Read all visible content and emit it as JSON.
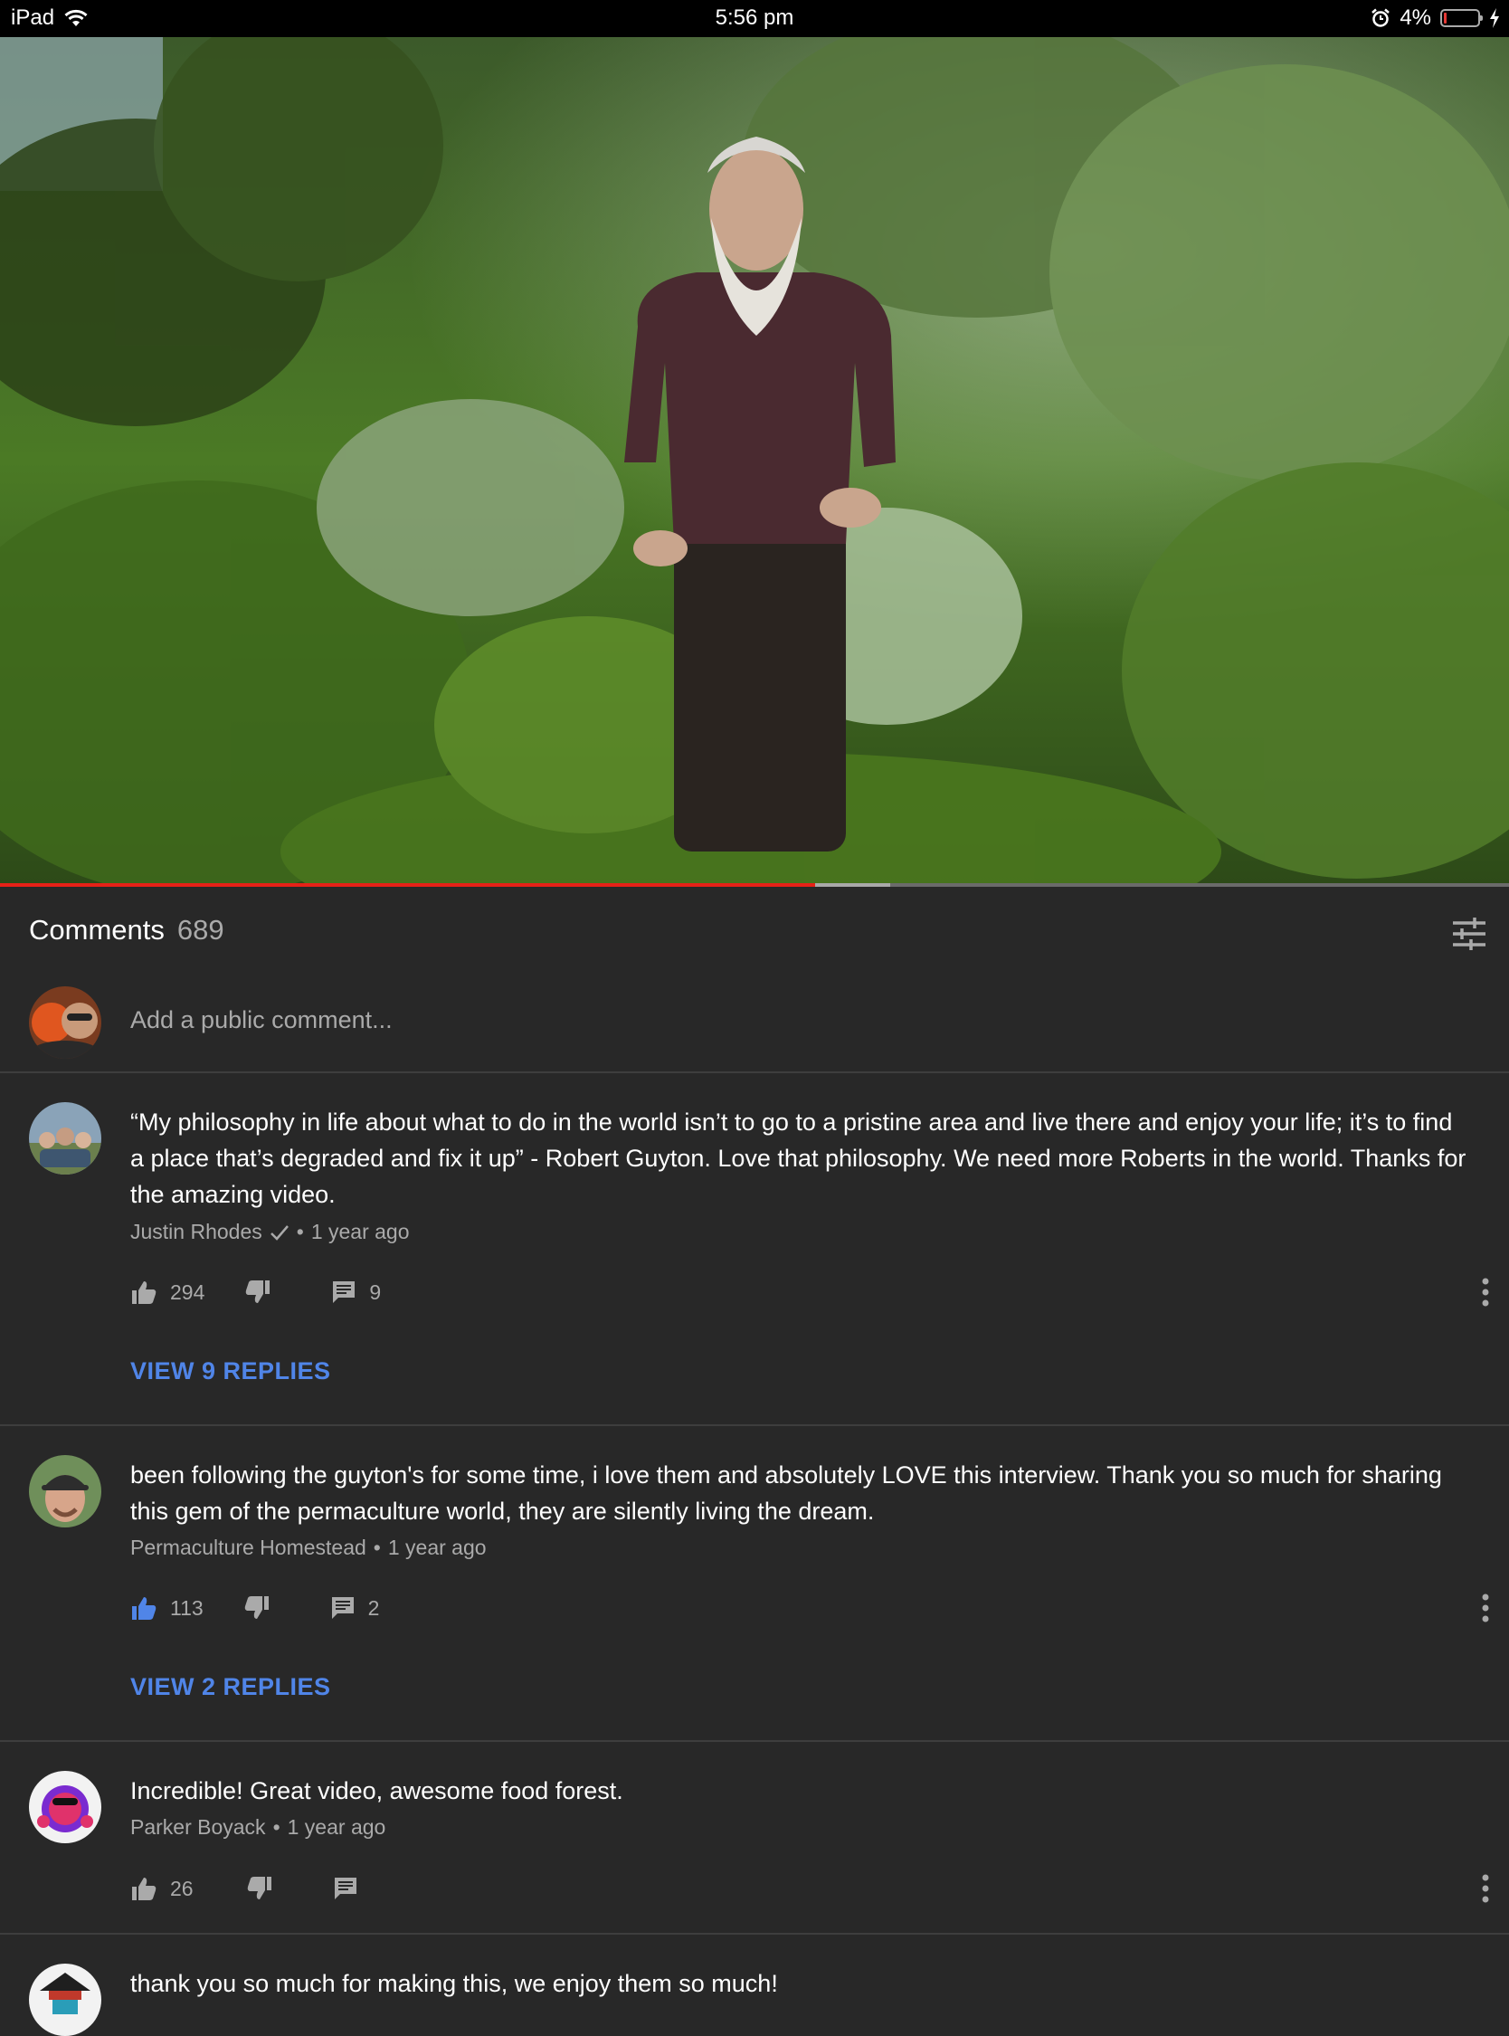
{
  "status_bar": {
    "device": "iPad",
    "time": "5:56 pm",
    "battery": "4%"
  },
  "video": {
    "progress_fraction": 0.54,
    "buffered_fraction": 0.59
  },
  "comments_header": {
    "title": "Comments",
    "count": "689"
  },
  "add_comment": {
    "placeholder": "Add a public comment..."
  },
  "comments": [
    {
      "text": "“My philosophy in life about what to do in the world isn’t to go to a pristine area and live there and enjoy your life; it’s to find a place that’s degraded and fix it up” - Robert Guyton.    Love that philosophy. We need more Roberts in the world. Thanks for the amazing video.",
      "author": "Justin Rhodes",
      "verified": true,
      "time": "1 year ago",
      "likes": "294",
      "replies_count": "9",
      "view_replies": "VIEW 9 REPLIES",
      "liked": false
    },
    {
      "text": "been following the guyton's for some time, i love them and absolutely LOVE this interview. Thank you so much for sharing this gem of the permaculture world, they are silently living the dream.",
      "author": "Permaculture Homestead",
      "verified": false,
      "time": "1 year ago",
      "likes": "113",
      "replies_count": "2",
      "view_replies": "VIEW 2 REPLIES",
      "liked": true
    },
    {
      "text": "Incredible! Great video, awesome food forest.",
      "author": "Parker Boyack",
      "verified": false,
      "time": "1 year ago",
      "likes": "26",
      "replies_count": "",
      "view_replies": "",
      "liked": false
    },
    {
      "text": "thank you so much for making this, we enjoy them so much!"
    }
  ],
  "colors": {
    "background": "#282828",
    "accent_blue": "#5085e8",
    "progress_red": "#e62117"
  }
}
